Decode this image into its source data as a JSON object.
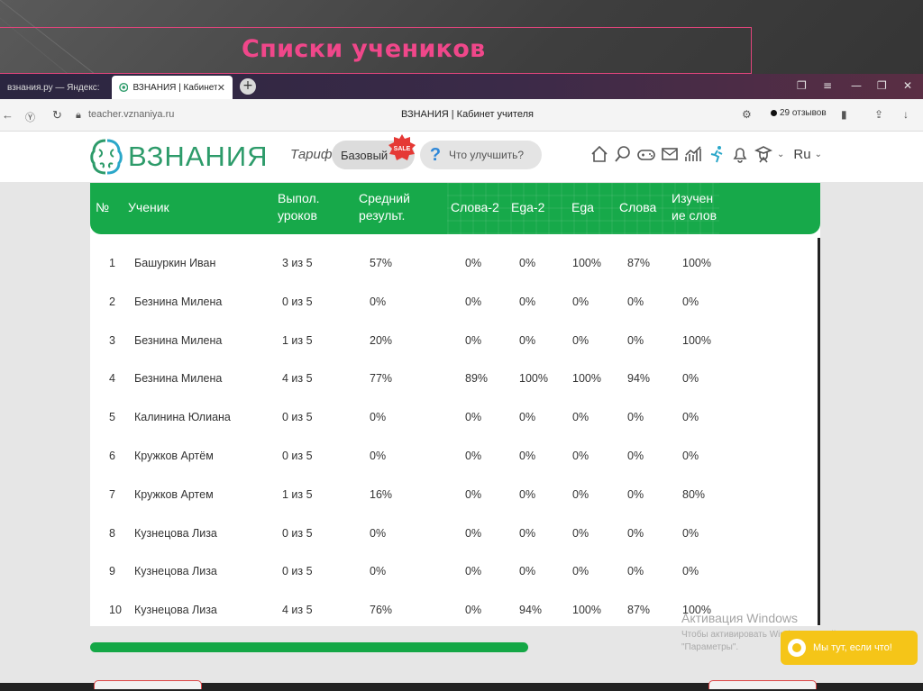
{
  "slide": {
    "title": "Списки учеников"
  },
  "browser": {
    "tabs": [
      {
        "label": "взнания.ру — Яндекс: нач"
      },
      {
        "label": "ВЗНАНИЯ | Кабинет уч",
        "active": true
      }
    ],
    "new_tab": "+",
    "url": "teacher.vznaniya.ru",
    "page_title": "ВЗНАНИЯ | Кабинет учителя",
    "reviews": "29 отзывов"
  },
  "header": {
    "logo": "ВЗНАНИЯ",
    "tariff_label": "Тариф",
    "tariff_value": "Базовый",
    "sale_badge": "SALE",
    "improve": "Что улучшить?",
    "improve_icon": "?",
    "language": "Ru"
  },
  "table": {
    "columns": [
      "№",
      "Ученик",
      "Выпол. уроков",
      "Средний результ.",
      "Слова-2",
      "Ega-2",
      "Ega",
      "Слова",
      "Изучен ие слов"
    ],
    "rows": [
      [
        "1",
        "Башуркин Иван",
        "3 из 5",
        "57%",
        "0%",
        "0%",
        "100%",
        "87%",
        "100%"
      ],
      [
        "2",
        "Безнина Милена",
        "0 из 5",
        "0%",
        "0%",
        "0%",
        "0%",
        "0%",
        "0%"
      ],
      [
        "3",
        "Безнина Милена",
        "1 из 5",
        "20%",
        "0%",
        "0%",
        "0%",
        "0%",
        "100%"
      ],
      [
        "4",
        "Безнина Милена",
        "4 из 5",
        "77%",
        "89%",
        "100%",
        "100%",
        "94%",
        "0%"
      ],
      [
        "5",
        "Калинина Юлиана",
        "0 из 5",
        "0%",
        "0%",
        "0%",
        "0%",
        "0%",
        "0%"
      ],
      [
        "6",
        "Кружков Артём",
        "0 из 5",
        "0%",
        "0%",
        "0%",
        "0%",
        "0%",
        "0%"
      ],
      [
        "7",
        "Кружков Артем",
        "1 из 5",
        "16%",
        "0%",
        "0%",
        "0%",
        "0%",
        "80%"
      ],
      [
        "8",
        "Кузнецова Лиза",
        "0 из 5",
        "0%",
        "0%",
        "0%",
        "0%",
        "0%",
        "0%"
      ],
      [
        "9",
        "Кузнецова Лиза",
        "0 из 5",
        "0%",
        "0%",
        "0%",
        "0%",
        "0%",
        "0%"
      ],
      [
        "10",
        "Кузнецова Лиза",
        "4 из 5",
        "76%",
        "0%",
        "94%",
        "100%",
        "87%",
        "100%"
      ]
    ]
  },
  "watermark": {
    "title": "Активация Windows",
    "line1": "Чтобы активировать Windows, перейдите в раздел",
    "line2": "\"Параметры\"."
  },
  "chat": {
    "label": "Мы тут, если что!"
  },
  "colors": {
    "accent": "#17a94a",
    "brand": "#2d9b6a",
    "slide_title": "#f0478a",
    "chat": "#f5c518"
  }
}
